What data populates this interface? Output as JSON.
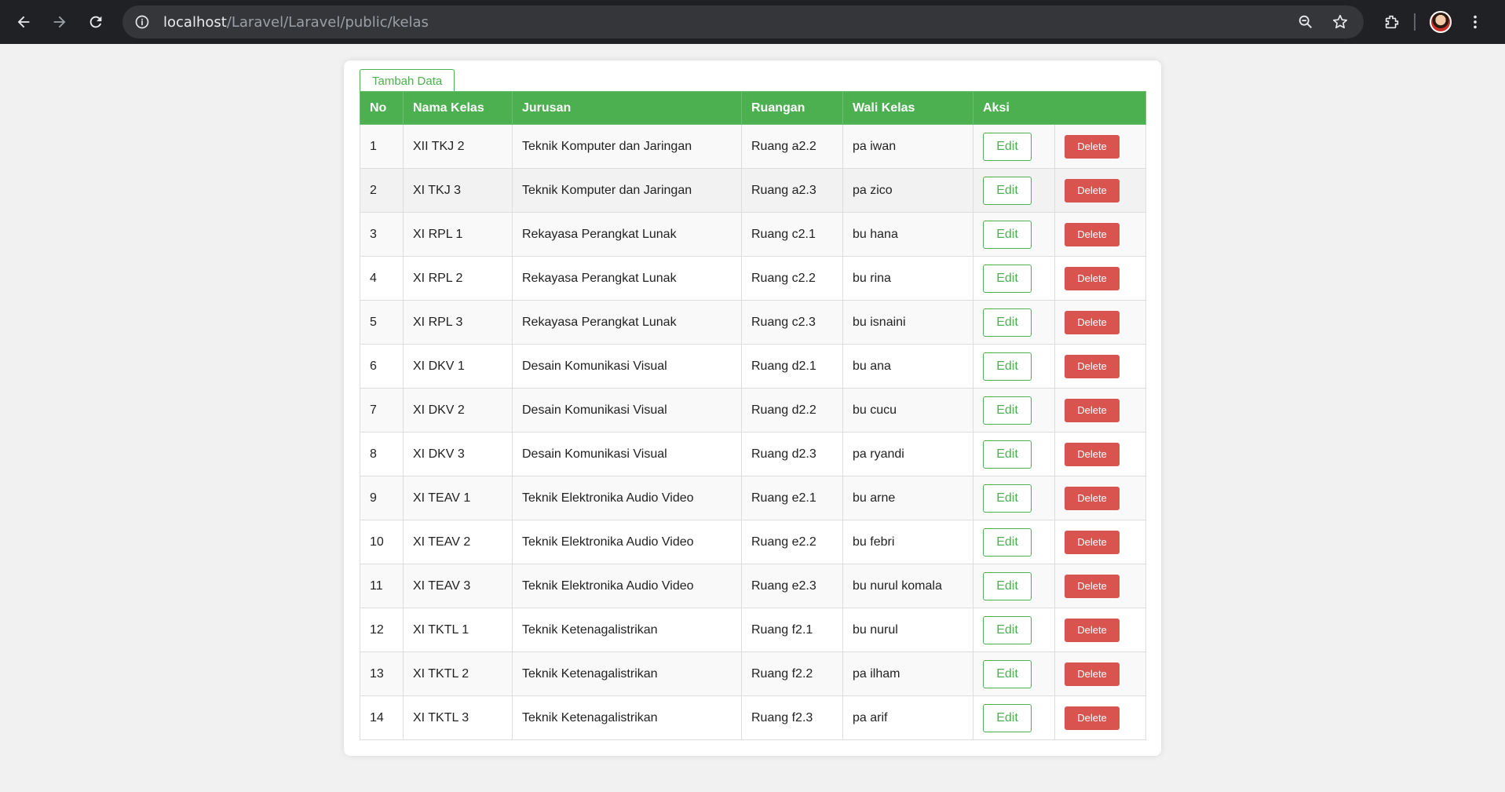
{
  "browser": {
    "url_host": "localhost",
    "url_path": "/Laravel/Laravel/public/kelas"
  },
  "page": {
    "add_button_label": "Tambah Data",
    "columns": [
      "No",
      "Nama Kelas",
      "Jurusan",
      "Ruangan",
      "Wali Kelas",
      "Aksi"
    ],
    "edit_label": "Edit",
    "delete_label": "Delete",
    "rows": [
      {
        "no": "1",
        "nama_kelas": "XII TKJ 2",
        "jurusan": "Teknik Komputer dan Jaringan",
        "ruangan": "Ruang a2.2",
        "wali_kelas": "pa iwan"
      },
      {
        "no": "2",
        "nama_kelas": "XI TKJ 3",
        "jurusan": "Teknik Komputer dan Jaringan",
        "ruangan": "Ruang a2.3",
        "wali_kelas": "pa zico"
      },
      {
        "no": "3",
        "nama_kelas": "XI RPL 1",
        "jurusan": "Rekayasa Perangkat Lunak",
        "ruangan": "Ruang c2.1",
        "wali_kelas": "bu hana"
      },
      {
        "no": "4",
        "nama_kelas": "XI RPL 2",
        "jurusan": "Rekayasa Perangkat Lunak",
        "ruangan": "Ruang c2.2",
        "wali_kelas": "bu rina"
      },
      {
        "no": "5",
        "nama_kelas": "XI RPL 3",
        "jurusan": "Rekayasa Perangkat Lunak",
        "ruangan": "Ruang c2.3",
        "wali_kelas": "bu isnaini"
      },
      {
        "no": "6",
        "nama_kelas": "XI DKV 1",
        "jurusan": "Desain Komunikasi Visual",
        "ruangan": "Ruang d2.1",
        "wali_kelas": "bu ana"
      },
      {
        "no": "7",
        "nama_kelas": "XI DKV 2",
        "jurusan": "Desain Komunikasi Visual",
        "ruangan": "Ruang d2.2",
        "wali_kelas": "bu cucu"
      },
      {
        "no": "8",
        "nama_kelas": "XI DKV 3",
        "jurusan": "Desain Komunikasi Visual",
        "ruangan": "Ruang d2.3",
        "wali_kelas": "pa ryandi"
      },
      {
        "no": "9",
        "nama_kelas": "XI TEAV 1",
        "jurusan": "Teknik Elektronika Audio Video",
        "ruangan": "Ruang e2.1",
        "wali_kelas": "bu arne"
      },
      {
        "no": "10",
        "nama_kelas": "XI TEAV 2",
        "jurusan": "Teknik Elektronika Audio Video",
        "ruangan": "Ruang e2.2",
        "wali_kelas": "bu febri"
      },
      {
        "no": "11",
        "nama_kelas": "XI TEAV 3",
        "jurusan": "Teknik Elektronika Audio Video",
        "ruangan": "Ruang e2.3",
        "wali_kelas": "bu nurul komala"
      },
      {
        "no": "12",
        "nama_kelas": "XI TKTL 1",
        "jurusan": "Teknik Ketenagalistrikan",
        "ruangan": "Ruang f2.1",
        "wali_kelas": "bu nurul"
      },
      {
        "no": "13",
        "nama_kelas": "XI TKTL 2",
        "jurusan": "Teknik Ketenagalistrikan",
        "ruangan": "Ruang f2.2",
        "wali_kelas": "pa ilham"
      },
      {
        "no": "14",
        "nama_kelas": "XI TKTL 3",
        "jurusan": "Teknik Ketenagalistrikan",
        "ruangan": "Ruang f2.3",
        "wali_kelas": "pa arif"
      }
    ]
  },
  "colors": {
    "header_green": "#4caf50",
    "delete_red": "#d9534f"
  }
}
